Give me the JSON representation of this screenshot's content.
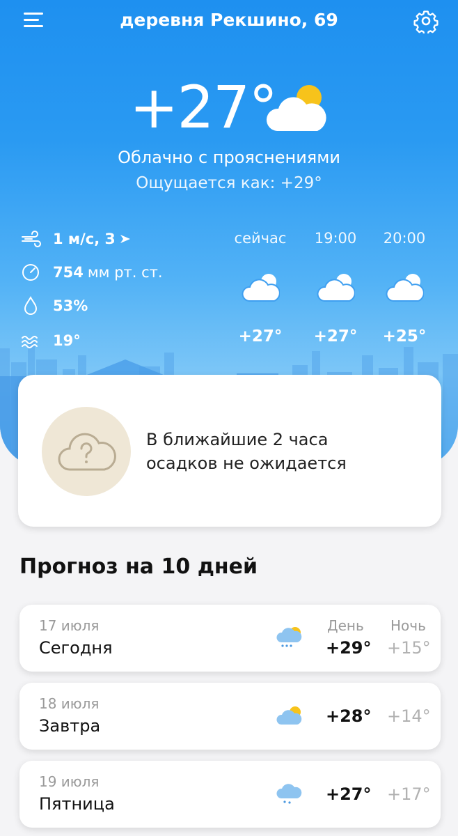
{
  "header": {
    "location": "деревня Рекшино, 69"
  },
  "current": {
    "temperature": "+27°",
    "condition": "Облачно с прояснениями",
    "feels_like": "Ощущается как: +29°"
  },
  "params": {
    "wind_value": "1 м/с, З",
    "pressure_value": "754",
    "pressure_unit": "мм рт. ст.",
    "humidity": "53%",
    "water_temp": "19°"
  },
  "hourly": [
    {
      "time": "сейчас",
      "temp": "+27°",
      "icon": "partly-cloudy-icon"
    },
    {
      "time": "19:00",
      "temp": "+27°",
      "icon": "partly-cloudy-icon"
    },
    {
      "time": "20:00",
      "temp": "+25°",
      "icon": "partly-cloudy-icon"
    }
  ],
  "nowcast": {
    "line1": "В ближайшие 2 часа",
    "line2": "осадков не ожидается",
    "icon": "cloud-question-icon"
  },
  "forecast": {
    "title": "Прогноз на 10 дней",
    "day_label": "День",
    "night_label": "Ночь",
    "days": [
      {
        "date": "17 июля",
        "name": "Сегодня",
        "day": "+29°",
        "night": "+15°",
        "icon": "sun-cloud-rain-icon"
      },
      {
        "date": "18 июля",
        "name": "Завтра",
        "day": "+28°",
        "night": "+14°",
        "icon": "sun-cloud-icon"
      },
      {
        "date": "19 июля",
        "name": "Пятница",
        "day": "+27°",
        "night": "+17°",
        "icon": "cloud-rain-icon"
      }
    ]
  },
  "colors": {
    "sky_top": "#1e90f0",
    "sun": "#f7c31b",
    "card_bg": "#ffffff",
    "muted": "#9a9a9a"
  }
}
